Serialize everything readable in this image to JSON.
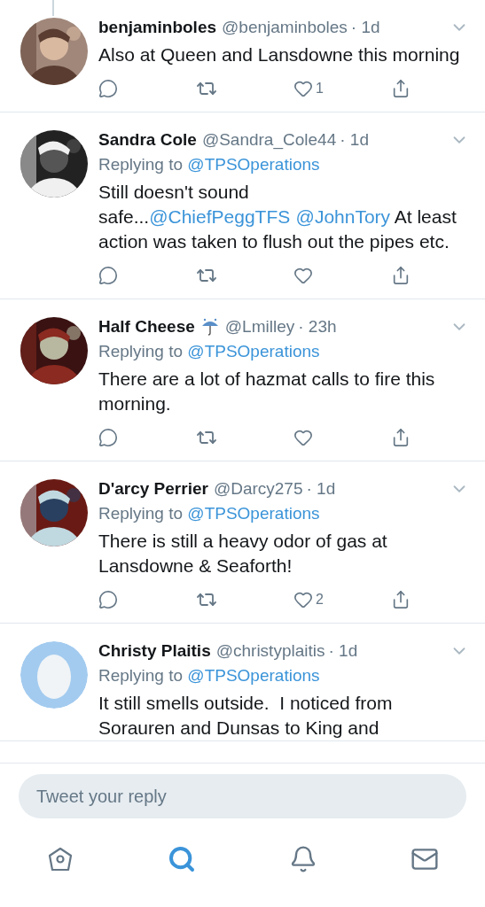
{
  "tweets": [
    {
      "name": "benjaminboles",
      "handle": "@benjaminboles",
      "time": "· 1d",
      "name_emoji": false,
      "cut_off": false,
      "body": [
        {
          "kind": "text",
          "text": "Also at Queen and Lansdowne this morning"
        }
      ],
      "likes": "1"
    },
    {
      "name": "Sandra Cole",
      "handle": "@Sandra_Cole44",
      "time": "· 1d",
      "name_emoji": false,
      "cut_off": false,
      "reply_to": {
        "label": "Replying to",
        "target": "@TPSOperations"
      },
      "body": [
        {
          "kind": "text",
          "text": "Still doesn't sound safe..."
        },
        {
          "kind": "link",
          "text": "@ChiefPeggTFS"
        },
        {
          "kind": "link",
          "text": "@JohnTory"
        },
        {
          "kind": "text",
          "text": " At least action was taken to flush out the pipes etc."
        }
      ]
    },
    {
      "name": "Half Cheese",
      "handle": "@Lmilley",
      "time": "· 23h",
      "name_emoji": true,
      "cut_off": false,
      "reply_to": {
        "label": "Replying to",
        "target": "@TPSOperations"
      },
      "body": [
        {
          "kind": "text",
          "text": "There are a lot of hazmat calls to fire this morning."
        }
      ]
    },
    {
      "name": "D'arcy Perrier",
      "handle": "@Darcy275",
      "time": "· 1d",
      "name_emoji": false,
      "cut_off": false,
      "reply_to": {
        "label": "Replying to",
        "target": "@TPSOperations"
      },
      "body": [
        {
          "kind": "text",
          "text": "There is still a heavy odor of gas at Lansdowne & Seaforth!"
        }
      ],
      "likes": "2"
    },
    {
      "kind": "egg",
      "name": "Christy Plaitis",
      "handle": "@christyplaitis",
      "time": "· 1d",
      "name_emoji": false,
      "cut_off": true,
      "reply_to": {
        "label": "Replying to",
        "target": "@TPSOperations"
      },
      "body": [
        {
          "kind": "text",
          "text": "It still smells outside.  I noticed from Sorauren and Dunsas to King and"
        }
      ]
    }
  ],
  "reply": {
    "placeholder": "Tweet your reply"
  },
  "nav": [
    {
      "selected": false
    },
    {
      "selected": true
    },
    {
      "selected": false
    },
    {
      "selected": false
    }
  ]
}
